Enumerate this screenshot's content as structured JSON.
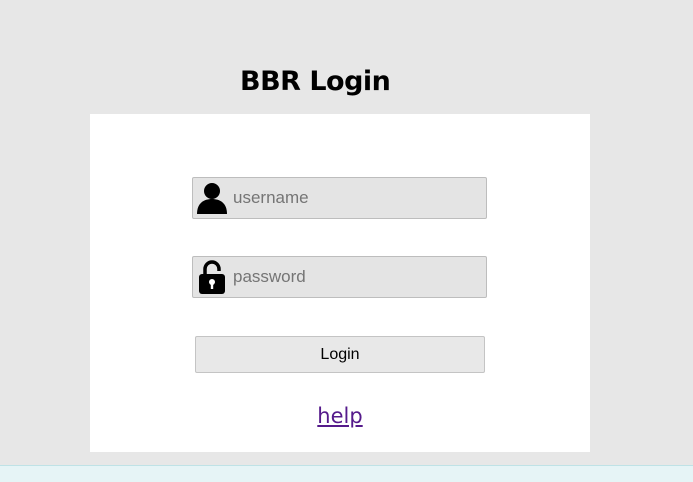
{
  "header": {
    "title": "BBR Login"
  },
  "form": {
    "username": {
      "placeholder": "username",
      "value": "",
      "icon": "user-icon"
    },
    "password": {
      "placeholder": "password",
      "value": "",
      "icon": "padlock-icon"
    },
    "login_label": "Login",
    "help_label": "help"
  },
  "colors": {
    "page_background": "#e7e7e7",
    "card_background": "#ffffff",
    "field_background": "#e4e4e4",
    "link": "#551a8b",
    "footer_strip": "#e6f4f6"
  }
}
